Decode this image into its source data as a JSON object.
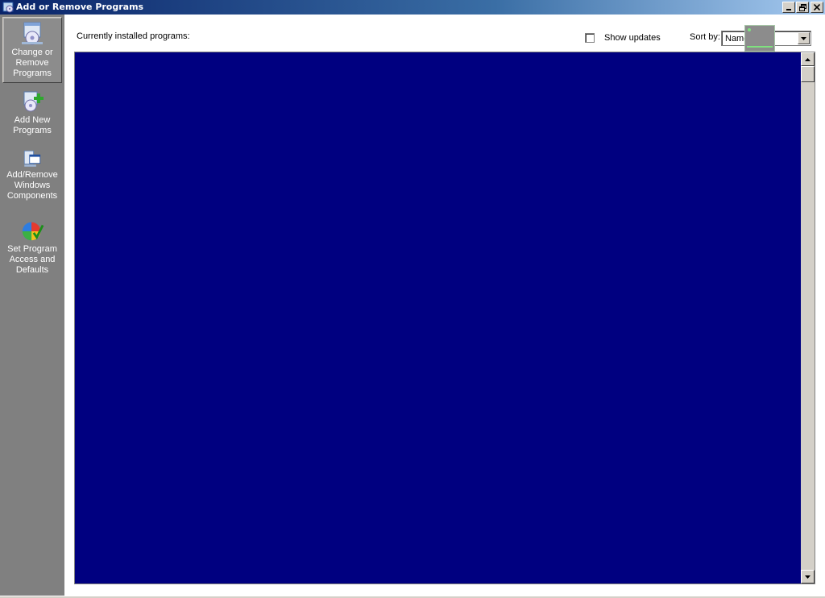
{
  "window": {
    "title": "Add or Remove Programs"
  },
  "sidebar": {
    "items": [
      {
        "label": "Change or\nRemove\nPrograms",
        "icon": "change-remove-programs-icon"
      },
      {
        "label": "Add New\nPrograms",
        "icon": "add-new-programs-icon"
      },
      {
        "label": "Add/Remove\nWindows\nComponents",
        "icon": "windows-components-icon"
      },
      {
        "label": "Set Program\nAccess and\nDefaults",
        "icon": "program-access-defaults-icon"
      }
    ]
  },
  "main": {
    "installed_label": "Currently installed programs:",
    "show_updates_label": "Show updates",
    "show_updates_checked": false,
    "sort_by_label": "Sort by:",
    "sort_by_value": "Name"
  },
  "colors": {
    "list_background": "#000080",
    "sidebar_background": "#808080"
  }
}
